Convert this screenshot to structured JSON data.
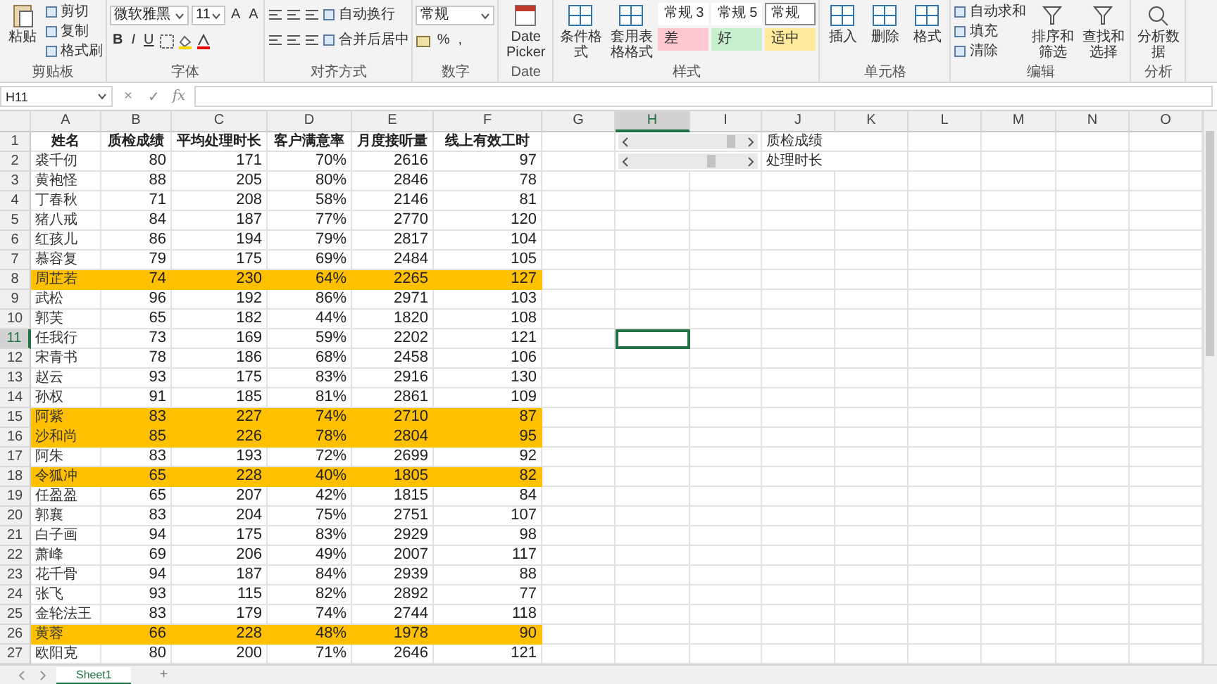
{
  "ribbon": {
    "groups": [
      {
        "kind": "clipboard",
        "label": "剪贴板",
        "paste": "粘贴",
        "tools": [
          "剪切",
          "复制",
          "格式刷"
        ]
      },
      {
        "kind": "font",
        "label": "字体",
        "font_name": "微软雅黑",
        "font_size": "11",
        "size_buttons": [
          "A",
          "A"
        ],
        "style_buttons": [
          "B",
          "I",
          "U"
        ]
      },
      {
        "kind": "alignment",
        "label": "对齐方式",
        "wrap": "自动换行",
        "merge": "合并后居中"
      },
      {
        "kind": "number",
        "label": "数字",
        "format": "常规",
        "symbols": [
          "%",
          ","
        ]
      },
      {
        "kind": "date",
        "label": "Date",
        "button": "Date Picker"
      },
      {
        "kind": "styles",
        "label": "样式",
        "buttons": [
          "条件格式",
          "套用表格格式"
        ],
        "cell_styles": [
          {
            "label": "常规 3",
            "color": "#ffffff",
            "selected": false
          },
          {
            "label": "常规 5",
            "color": "#ffffff",
            "selected": false
          },
          {
            "label": "常规",
            "color": "#ffffff",
            "selected": true
          },
          {
            "label": "差",
            "color": "#ffc7ce",
            "selected": false
          },
          {
            "label": "好",
            "color": "#c6efce",
            "selected": false
          },
          {
            "label": "适中",
            "color": "#ffeb9c",
            "selected": false
          }
        ]
      },
      {
        "kind": "cells",
        "label": "单元格",
        "buttons": [
          "插入",
          "删除",
          "格式"
        ]
      },
      {
        "kind": "editing",
        "label": "编辑",
        "tools": [
          "自动求和",
          "填充",
          "清除"
        ],
        "buttons": [
          "排序和筛选",
          "查找和选择"
        ]
      },
      {
        "kind": "analysis",
        "label": "分析",
        "buttons": [
          "分析数据"
        ]
      }
    ]
  },
  "formula_bar": {
    "name_box": "H11",
    "cancel": "×",
    "enter": "✓",
    "function": "fx"
  },
  "sheet": {
    "columns": [
      {
        "label": "A",
        "selected": false
      },
      {
        "label": "B",
        "selected": false
      },
      {
        "label": "C",
        "selected": false
      },
      {
        "label": "D",
        "selected": false
      },
      {
        "label": "E",
        "selected": false
      },
      {
        "label": "F",
        "selected": false
      },
      {
        "label": "G",
        "selected": false
      },
      {
        "label": "H",
        "selected": true
      },
      {
        "label": "I",
        "selected": false
      },
      {
        "label": "J",
        "selected": false
      },
      {
        "label": "K",
        "selected": false
      },
      {
        "label": "L",
        "selected": false
      },
      {
        "label": "M",
        "selected": false
      },
      {
        "label": "N",
        "selected": false
      },
      {
        "label": "O",
        "selected": false
      }
    ],
    "rows": [
      {
        "number": "1",
        "kind": "header",
        "selected": false,
        "highlighted": false,
        "cells": [
          "姓名",
          "质检成绩",
          "平均处理时长",
          "客户满意率",
          "月度接听量",
          "线上有效工时"
        ],
        "scrollbar": {
          "level": 0.92
        },
        "note": "质检成绩"
      },
      {
        "number": "2",
        "kind": "data",
        "selected": false,
        "highlighted": false,
        "cells": [
          "裘千仞",
          "80",
          "171",
          "70%",
          "2616",
          "97"
        ],
        "scrollbar": {
          "level": 0.72
        },
        "note": "处理时长"
      },
      {
        "number": "3",
        "kind": "data",
        "selected": false,
        "highlighted": false,
        "cells": [
          "黄袍怪",
          "88",
          "205",
          "80%",
          "2846",
          "78"
        ]
      },
      {
        "number": "4",
        "kind": "data",
        "selected": false,
        "highlighted": false,
        "cells": [
          "丁春秋",
          "71",
          "208",
          "58%",
          "2146",
          "81"
        ]
      },
      {
        "number": "5",
        "kind": "data",
        "selected": false,
        "highlighted": false,
        "cells": [
          "猪八戒",
          "84",
          "187",
          "77%",
          "2770",
          "120"
        ]
      },
      {
        "number": "6",
        "kind": "data",
        "selected": false,
        "highlighted": false,
        "cells": [
          "红孩儿",
          "86",
          "194",
          "79%",
          "2817",
          "104"
        ]
      },
      {
        "number": "7",
        "kind": "data",
        "selected": false,
        "highlighted": false,
        "cells": [
          "慕容复",
          "79",
          "175",
          "69%",
          "2484",
          "105"
        ]
      },
      {
        "number": "8",
        "kind": "data",
        "selected": false,
        "highlighted": true,
        "cells": [
          "周芷若",
          "74",
          "230",
          "64%",
          "2265",
          "127"
        ]
      },
      {
        "number": "9",
        "kind": "data",
        "selected": false,
        "highlighted": false,
        "cells": [
          "武松",
          "96",
          "192",
          "86%",
          "2971",
          "103"
        ]
      },
      {
        "number": "10",
        "kind": "data",
        "selected": false,
        "highlighted": false,
        "cells": [
          "郭芙",
          "65",
          "182",
          "44%",
          "1820",
          "108"
        ]
      },
      {
        "number": "11",
        "kind": "data",
        "selected": true,
        "highlighted": false,
        "cells": [
          "任我行",
          "73",
          "169",
          "59%",
          "2202",
          "121"
        ]
      },
      {
        "number": "12",
        "kind": "data",
        "selected": false,
        "highlighted": false,
        "cells": [
          "宋青书",
          "78",
          "186",
          "68%",
          "2458",
          "106"
        ]
      },
      {
        "number": "13",
        "kind": "data",
        "selected": false,
        "highlighted": false,
        "cells": [
          "赵云",
          "93",
          "175",
          "83%",
          "2916",
          "130"
        ]
      },
      {
        "number": "14",
        "kind": "data",
        "selected": false,
        "highlighted": false,
        "cells": [
          "孙权",
          "91",
          "185",
          "81%",
          "2861",
          "109"
        ]
      },
      {
        "number": "15",
        "kind": "data",
        "selected": false,
        "highlighted": true,
        "cells": [
          "阿紫",
          "83",
          "227",
          "74%",
          "2710",
          "87"
        ]
      },
      {
        "number": "16",
        "kind": "data",
        "selected": false,
        "highlighted": true,
        "cells": [
          "沙和尚",
          "85",
          "226",
          "78%",
          "2804",
          "95"
        ]
      },
      {
        "number": "17",
        "kind": "data",
        "selected": false,
        "highlighted": false,
        "cells": [
          "阿朱",
          "83",
          "193",
          "72%",
          "2699",
          "92"
        ]
      },
      {
        "number": "18",
        "kind": "data",
        "selected": false,
        "highlighted": true,
        "cells": [
          "令狐冲",
          "65",
          "228",
          "40%",
          "1805",
          "82"
        ]
      },
      {
        "number": "19",
        "kind": "data",
        "selected": false,
        "highlighted": false,
        "cells": [
          "任盈盈",
          "65",
          "207",
          "42%",
          "1815",
          "84"
        ]
      },
      {
        "number": "20",
        "kind": "data",
        "selected": false,
        "highlighted": false,
        "cells": [
          "郭襄",
          "83",
          "204",
          "75%",
          "2751",
          "107"
        ]
      },
      {
        "number": "21",
        "kind": "data",
        "selected": false,
        "highlighted": false,
        "cells": [
          "白子画",
          "94",
          "175",
          "83%",
          "2929",
          "98"
        ]
      },
      {
        "number": "22",
        "kind": "data",
        "selected": false,
        "highlighted": false,
        "cells": [
          "萧峰",
          "69",
          "206",
          "49%",
          "2007",
          "117"
        ]
      },
      {
        "number": "23",
        "kind": "data",
        "selected": false,
        "highlighted": false,
        "cells": [
          "花千骨",
          "94",
          "187",
          "84%",
          "2939",
          "88"
        ]
      },
      {
        "number": "24",
        "kind": "data",
        "selected": false,
        "highlighted": false,
        "cells": [
          "张飞",
          "93",
          "115",
          "82%",
          "2892",
          "77"
        ]
      },
      {
        "number": "25",
        "kind": "data",
        "selected": false,
        "highlighted": false,
        "cells": [
          "金轮法王",
          "83",
          "179",
          "74%",
          "2744",
          "118"
        ]
      },
      {
        "number": "26",
        "kind": "data",
        "selected": false,
        "highlighted": true,
        "cells": [
          "黄蓉",
          "66",
          "228",
          "48%",
          "1978",
          "90"
        ]
      },
      {
        "number": "27",
        "kind": "data",
        "selected": false,
        "highlighted": false,
        "cells": [
          "欧阳克",
          "80",
          "200",
          "71%",
          "2646",
          "121"
        ]
      }
    ]
  },
  "sheet_tabs": {
    "tabs": [
      {
        "label": "Sheet1",
        "selected": true
      }
    ],
    "add": "+"
  }
}
